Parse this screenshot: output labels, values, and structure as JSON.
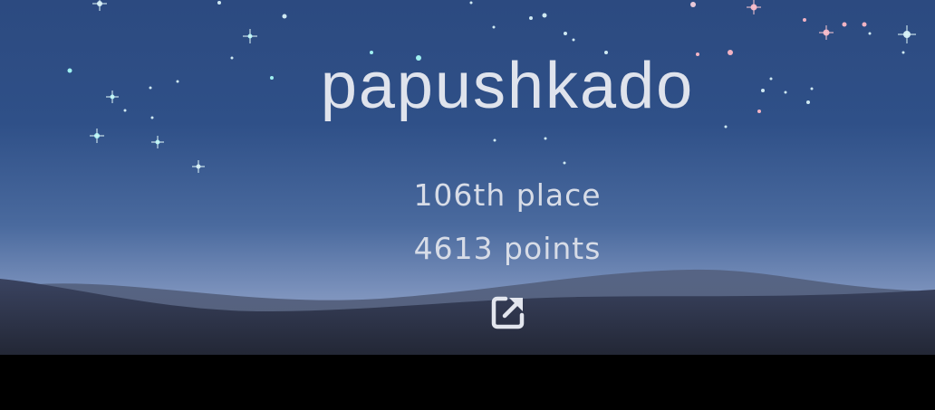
{
  "profile": {
    "username": "papushkado",
    "rank": "106th place",
    "points": "4613 points"
  },
  "link": {
    "icon": "external-link-icon"
  },
  "colors": {
    "sky_top": "#2c4a80",
    "sky_horizon": "#8a9cc2",
    "text": "#dfe3ec",
    "hills": "#3a4358"
  }
}
